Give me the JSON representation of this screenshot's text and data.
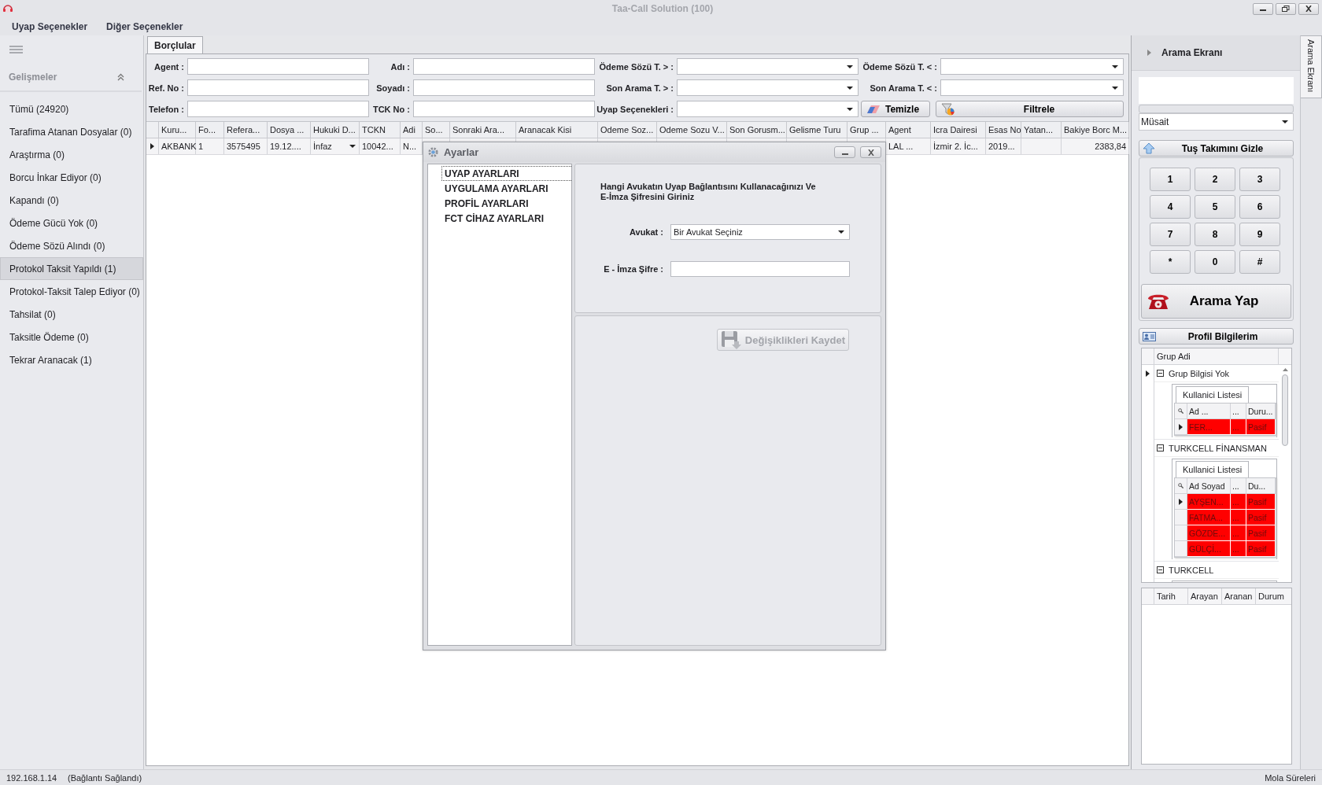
{
  "window": {
    "title": "Taa-Call Solution (100)"
  },
  "menu": [
    {
      "label": "Uyap Seçenekler"
    },
    {
      "label": "Diğer Seçenekler"
    }
  ],
  "sidebar": {
    "header": "Gelişmeler",
    "items": [
      {
        "label": "Tümü (24920)",
        "selected": false
      },
      {
        "label": "Tarafima Atanan Dosyalar (0)",
        "selected": false
      },
      {
        "label": "Araştırma (0)",
        "selected": false
      },
      {
        "label": "Borcu İnkar Ediyor (0)",
        "selected": false
      },
      {
        "label": "Kapandı (0)",
        "selected": false
      },
      {
        "label": "Ödeme Gücü Yok (0)",
        "selected": false
      },
      {
        "label": "Ödeme Sözü Alındı (0)",
        "selected": false
      },
      {
        "label": "Protokol Taksit Yapıldı (1)",
        "selected": true
      },
      {
        "label": "Protokol-Taksit Talep Ediyor (0)",
        "selected": false
      },
      {
        "label": "Tahsilat (0)",
        "selected": false
      },
      {
        "label": "Taksitle Ödeme (0)",
        "selected": false
      },
      {
        "label": "Tekrar Aranacak (1)",
        "selected": false
      }
    ]
  },
  "tabs": [
    {
      "label": "Borçlular",
      "selected": true
    }
  ],
  "filters": [
    {
      "kind": "text",
      "label": "Agent :"
    },
    {
      "kind": "text",
      "label": "Adı :"
    },
    {
      "kind": "dropdown",
      "label": "Ödeme Sözü T. > :"
    },
    {
      "kind": "dropdown",
      "label": "Ödeme Sözü T. < :"
    },
    {
      "kind": "text",
      "label": "Ref. No :"
    },
    {
      "kind": "text",
      "label": "Soyadı :"
    },
    {
      "kind": "dropdown",
      "label": "Son Arama T. > :"
    },
    {
      "kind": "dropdown",
      "label": "Son Arama T. < :"
    },
    {
      "kind": "text",
      "label": "Telefon :"
    },
    {
      "kind": "text",
      "label": "TCK No :"
    },
    {
      "kind": "dropdown",
      "label": "Uyap Seçenekleri :"
    }
  ],
  "filter_buttons": [
    {
      "label": "Temizle"
    },
    {
      "label": "Filtrele"
    }
  ],
  "grid": {
    "columns": [
      "Kuru...",
      "Fo...",
      "Refera...",
      "Dosya ...",
      "Hukuki D...",
      "TCKN",
      "Adi",
      "So...",
      "Sonraki Ara...",
      "Aranacak Kisi",
      "Odeme Soz...",
      "Odeme Sozu V...",
      "Son Gorusm...",
      "Gelisme Turu",
      "Grup ...",
      "Agent",
      "Icra Dairesi",
      "Esas No",
      "Yatan...",
      "Bakiye Borc M..."
    ],
    "rows": [
      {
        "selected": true,
        "cells": [
          {
            "kind": "text",
            "text": "AKBANK"
          },
          {
            "kind": "text",
            "text": "1"
          },
          {
            "kind": "text",
            "text": "3575495"
          },
          {
            "kind": "text",
            "text": "19.12...."
          },
          {
            "kind": "dropdown",
            "text": "İnfaz"
          },
          {
            "kind": "text",
            "text": "10042..."
          },
          {
            "kind": "text",
            "text": "N..."
          },
          null,
          null,
          null,
          null,
          null,
          null,
          null,
          null,
          {
            "kind": "text",
            "text": "LAL ..."
          },
          {
            "kind": "text",
            "text": "İzmir 2. İc..."
          },
          {
            "kind": "text",
            "text": "2019..."
          },
          null,
          {
            "kind": "number",
            "text": "2383,84"
          }
        ]
      }
    ]
  },
  "dialog": {
    "title": "Ayarlar",
    "nav": [
      {
        "label": "UYAP AYARLARI",
        "selected": true
      },
      {
        "label": "UYGULAMA AYARLARI",
        "selected": false
      },
      {
        "label": "PROFİL AYARLARI",
        "selected": false
      },
      {
        "label": "FCT CİHAZ AYARLARI",
        "selected": false
      }
    ],
    "instruction": "Hangi Avukatın Uyap Bağlantısını Kullanacağınızı Ve E-İmza Şifresini Giriniz",
    "fields": [
      {
        "kind": "dropdown",
        "label": "Avukat :",
        "value": "Bir Avukat Seçiniz"
      },
      {
        "kind": "password",
        "label": "E - İmza Şifre :"
      }
    ],
    "save_button": {
      "label": "Değişiklikleri Kaydet",
      "disabled": true
    }
  },
  "call_panel": {
    "header": "Arama Ekranı",
    "side_tab": "Arama Ekranı",
    "status": "Müsait",
    "keypad_toggle": "Tuş Takımını Gizle",
    "keys": [
      "1",
      "2",
      "3",
      "4",
      "5",
      "6",
      "7",
      "8",
      "9",
      "*",
      "0",
      "#"
    ],
    "call_button": "Arama Yap",
    "profile_button": "Profil Bilgilerim",
    "groups": {
      "column": "Grup Adi",
      "items": [
        {
          "name": "Grup Bilgisi Yok",
          "selected": true,
          "expanded": true,
          "subtab": "Kullanici Listesi",
          "columns": [
            "Ad ...",
            "...",
            "Duru..."
          ],
          "rows": [
            {
              "selected": true,
              "color": "#ff0000",
              "cells": [
                "FER...",
                "...",
                "Pasif"
              ]
            }
          ]
        },
        {
          "name": "TURKCELL FİNANSMAN",
          "selected": false,
          "expanded": true,
          "subtab": "Kullanici Listesi",
          "columns": [
            "Ad Soyad",
            "...",
            "Du..."
          ],
          "rows": [
            {
              "selected": true,
              "color": "#ff0000",
              "cells": [
                "AYŞEN...",
                "...",
                "Pasif"
              ]
            },
            {
              "selected": false,
              "color": "#ff0000",
              "cells": [
                "FATMA...",
                "...",
                "Pasif"
              ]
            },
            {
              "selected": false,
              "color": "#ff0000",
              "cells": [
                "GÖZDE...",
                "...",
                "Pasif"
              ]
            },
            {
              "selected": false,
              "color": "#ff0000",
              "cells": [
                "GÜLÇİ...",
                "...",
                "Pasif"
              ]
            }
          ]
        },
        {
          "name": "TURKCELL",
          "selected": false,
          "expanded": true
        }
      ]
    },
    "history": {
      "columns": [
        "Tarih",
        "Arayan",
        "Aranan",
        "Durum"
      ]
    }
  },
  "status_bar": {
    "address": "192.168.1.14",
    "connection": "(Bağlantı Sağlandı)",
    "right": "Mola Süreleri"
  }
}
